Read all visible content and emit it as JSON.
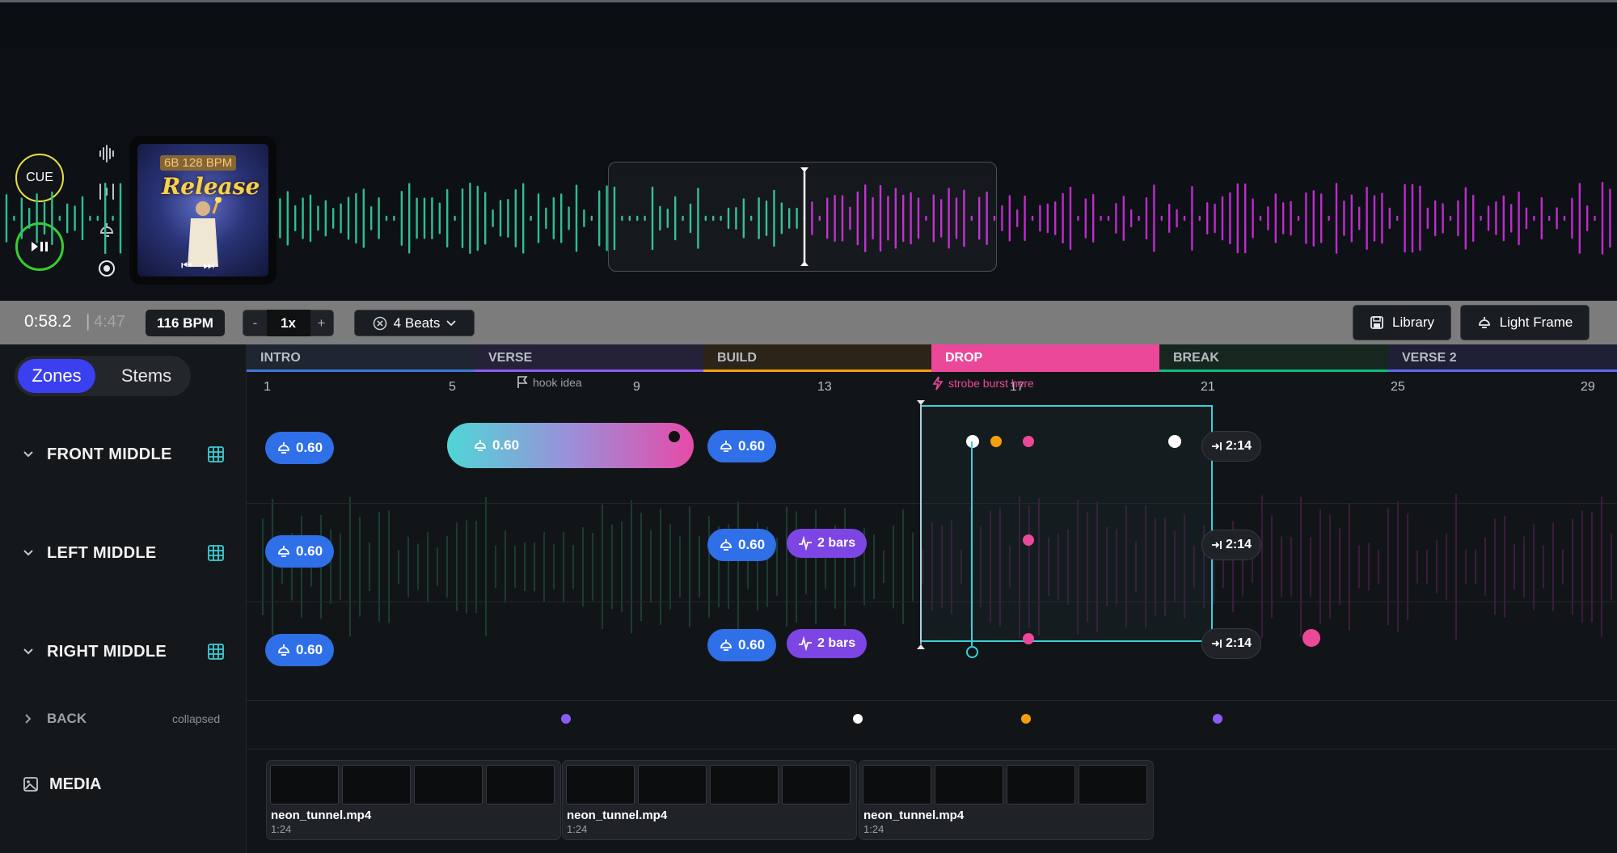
{
  "deck": {
    "cue_label": "CUE",
    "play_label": "⏯",
    "album": {
      "badge": "6B  128 BPM",
      "title": "Release",
      "prev_label": "⏮",
      "next_label": "⏭"
    },
    "side_icons": [
      "waveform-icon",
      "trim-icon",
      "light-icon",
      "target-icon"
    ]
  },
  "toolbar": {
    "time_current": "0:58.2",
    "time_separator": "|",
    "time_total": "4:47",
    "bpm": "116 BPM",
    "speed_minus": "-",
    "speed_value": "1x",
    "speed_plus": "+",
    "beats_label": "4 Beats",
    "library_label": "Library",
    "lightframe_label": "Light Frame"
  },
  "sidebar": {
    "zones_tab": "Zones",
    "stems_tab": "Stems",
    "zones": [
      {
        "name": "FRONT MIDDLE"
      },
      {
        "name": "LEFT MIDDLE"
      },
      {
        "name": "RIGHT MIDDLE"
      }
    ],
    "back": {
      "name": "BACK",
      "status": "collapsed"
    },
    "media": {
      "name": "MEDIA"
    }
  },
  "sections": [
    {
      "label": "INTRO",
      "color": "#3a7bd5"
    },
    {
      "label": "VERSE",
      "color": "#8b5cf6"
    },
    {
      "label": "BUILD",
      "color": "#f59e0b"
    },
    {
      "label": "DROP",
      "color": "#ec4899"
    },
    {
      "label": "BREAK",
      "color": "#10b981"
    },
    {
      "label": "VERSE 2",
      "color": "#6366f1"
    }
  ],
  "ruler": {
    "ticks": [
      "1",
      "5",
      "9",
      "13",
      "17",
      "21",
      "25",
      "29"
    ],
    "markers": [
      {
        "label": "hook idea",
        "icon": "flag-icon"
      },
      {
        "label": "strobe burst here",
        "icon": "bolt-icon"
      }
    ]
  },
  "chips": {
    "intensity": "0.60",
    "bars": "2 bars",
    "end_time": "2:14"
  },
  "media": [
    {
      "name": "neon_tunnel.mp4",
      "duration": "1:24"
    },
    {
      "name": "neon_tunnel.mp4",
      "duration": "1:24"
    },
    {
      "name": "neon_tunnel.mp4",
      "duration": "1:24"
    }
  ],
  "colors": {
    "accent": "#3a3ff0",
    "played_wave": "#2fbf8f",
    "upcoming_wave": "#c02ad0",
    "selection": "#3ccfd6",
    "cue_ring": "#e8e03a",
    "play_ring": "#34d02c"
  }
}
